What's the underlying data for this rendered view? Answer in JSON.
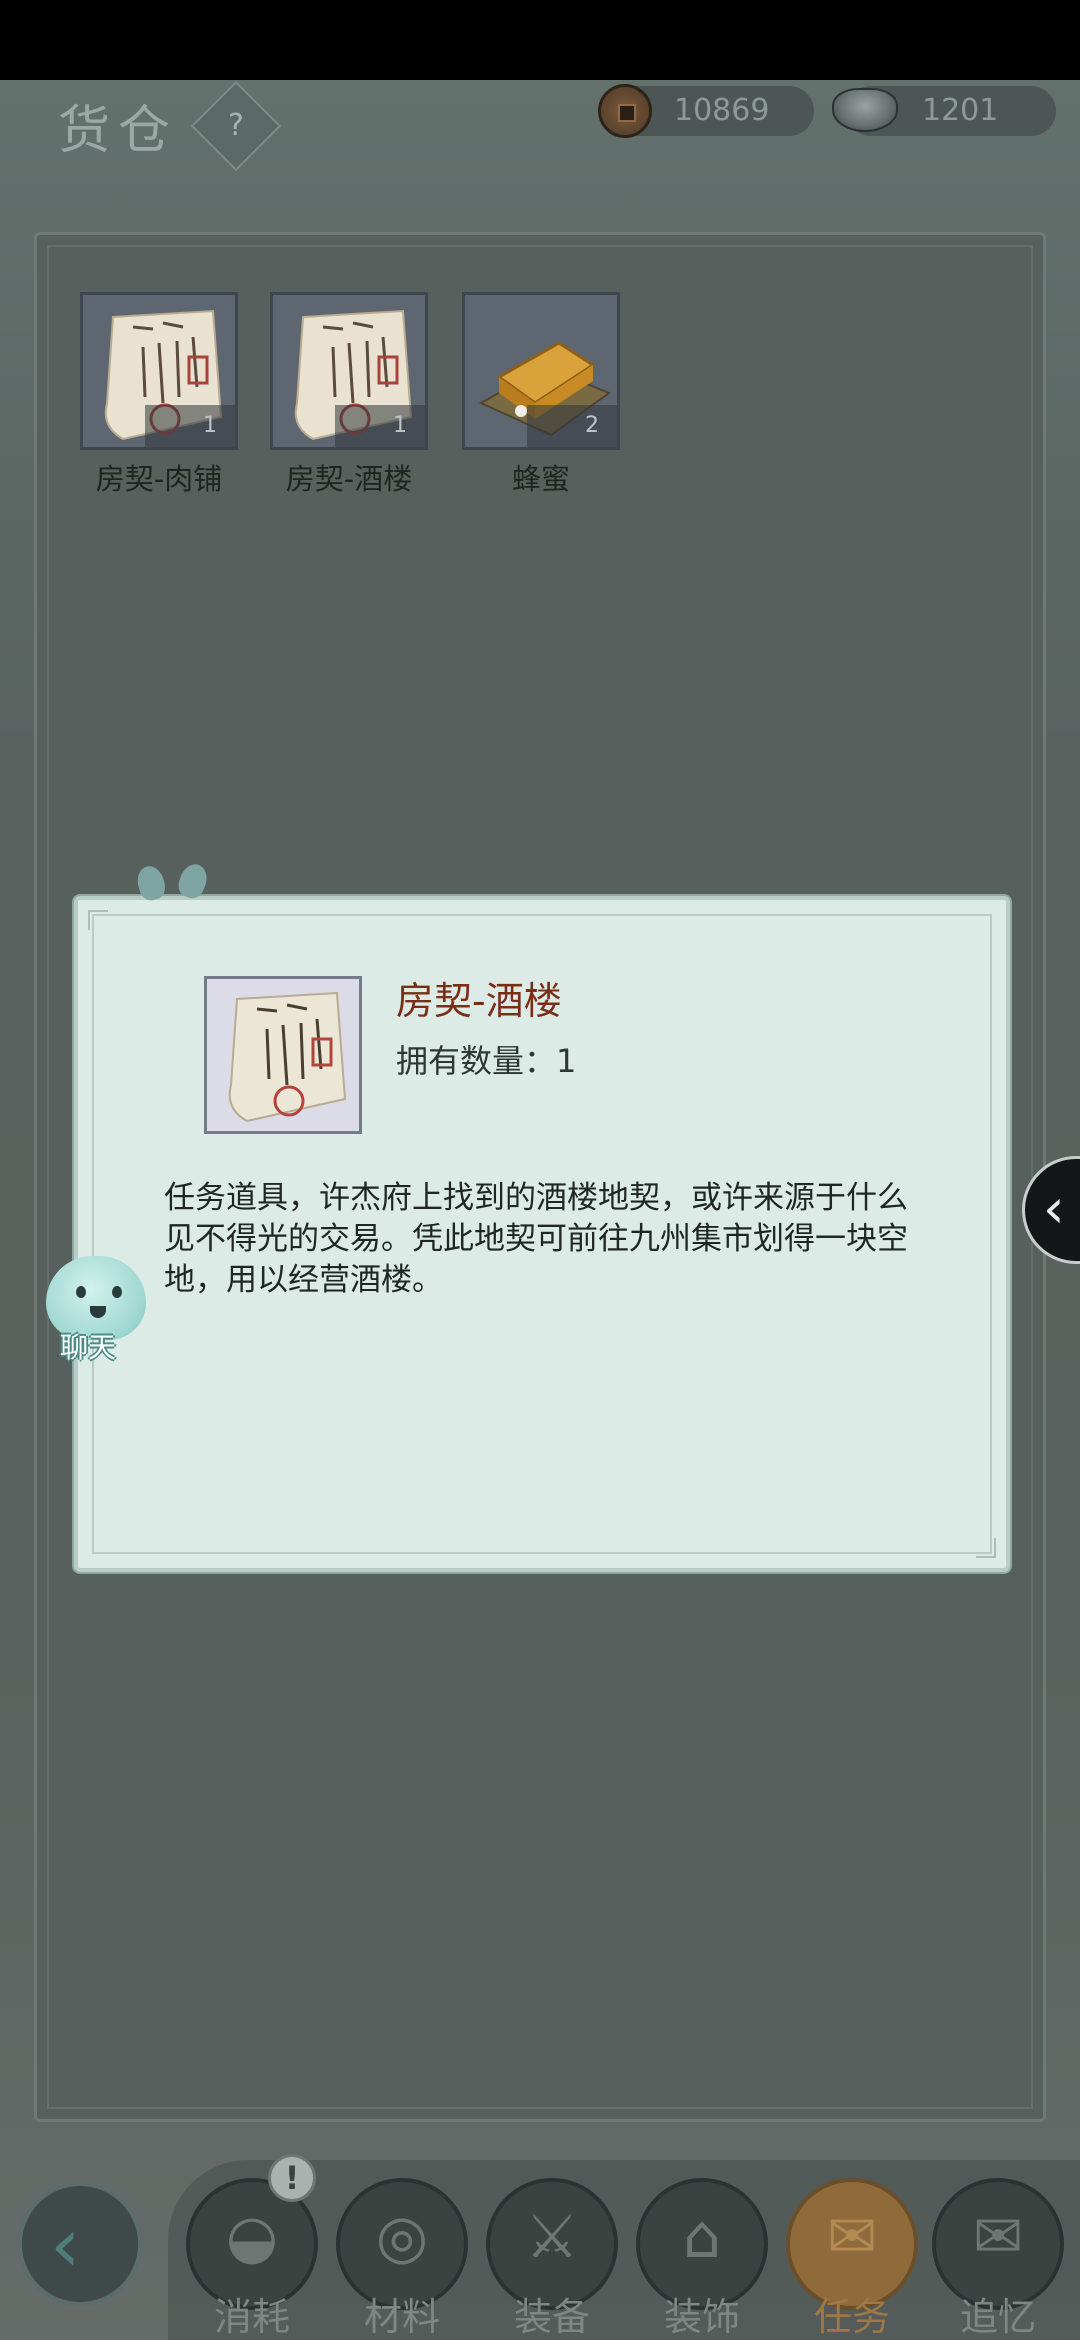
{
  "header": {
    "title": "货仓",
    "help_label": "?"
  },
  "currency": {
    "copper": "10869",
    "silver": "1201"
  },
  "items": [
    {
      "name": "房契-肉铺",
      "count": "1",
      "icon": "deed-scroll-icon"
    },
    {
      "name": "房契-酒楼",
      "count": "1",
      "icon": "deed-scroll-icon"
    },
    {
      "name": "蜂蜜",
      "count": "2",
      "icon": "honey-icon"
    }
  ],
  "dialog": {
    "name": "房契-酒楼",
    "quantity": "拥有数量：1",
    "description": "任务道具，许杰府上找到的酒楼地契，或许来源于什么见不得光的交易。凭此地契可前往九州集市划得一块空地，用以经营酒楼。"
  },
  "side_tab": {
    "glyph": "‹"
  },
  "chat": {
    "label": "聊天"
  },
  "bottom_nav": {
    "back_glyph": "‹",
    "alert_glyph": "!",
    "tabs": [
      {
        "label": "消耗",
        "glyph": "◒",
        "active": false
      },
      {
        "label": "材料",
        "glyph": "◎",
        "active": false
      },
      {
        "label": "装备",
        "glyph": "⚔",
        "active": false
      },
      {
        "label": "装饰",
        "glyph": "⌂",
        "active": false
      },
      {
        "label": "任务",
        "glyph": "✉",
        "active": true
      },
      {
        "label": "追忆",
        "glyph": "✉",
        "active": false
      }
    ]
  }
}
